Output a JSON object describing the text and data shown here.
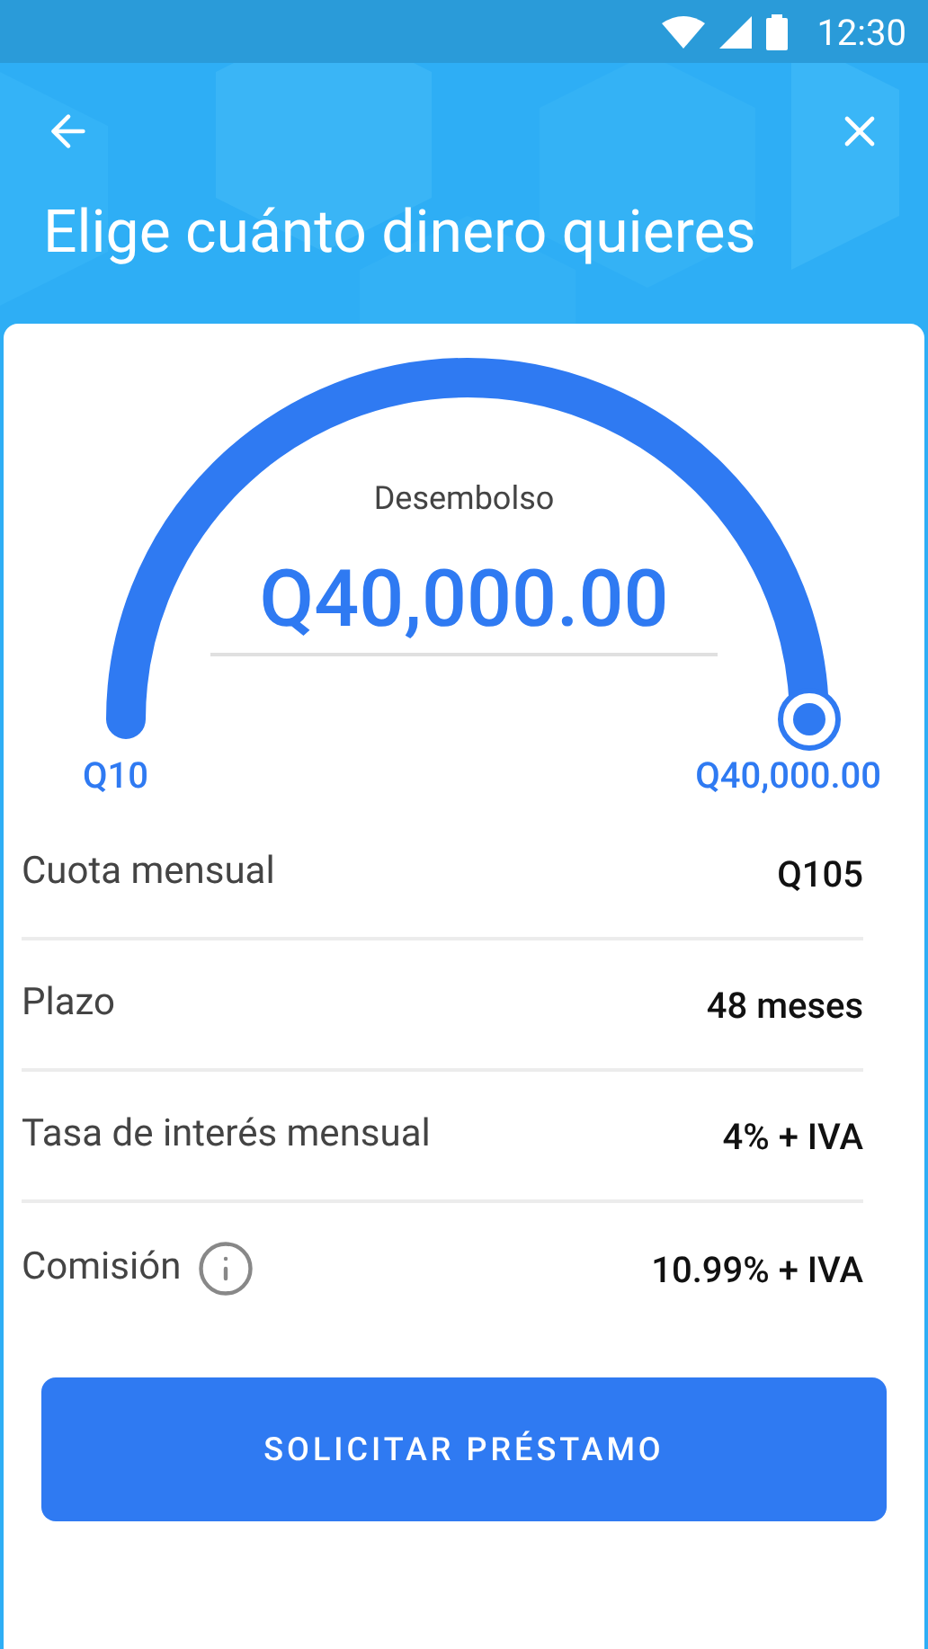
{
  "status_bar": {
    "time": "12:30"
  },
  "header": {
    "title": "Elige cuánto dinero quieres"
  },
  "gauge": {
    "label": "Desembolso",
    "amount": "Q40,000.00",
    "min_label": "Q10",
    "max_label": "Q40,000.00"
  },
  "details": [
    {
      "kind": "plain",
      "label": "Cuota mensual",
      "value": "Q105"
    },
    {
      "kind": "plain",
      "label": "Plazo",
      "value": "48 meses"
    },
    {
      "kind": "plain",
      "label": "Tasa de interés mensual",
      "value": "4% + IVA"
    },
    {
      "kind": "info",
      "label": "Comisión",
      "value": "10.99% + IVA"
    }
  ],
  "button": {
    "label": "SOLICITAR PRÉSTAMO"
  }
}
